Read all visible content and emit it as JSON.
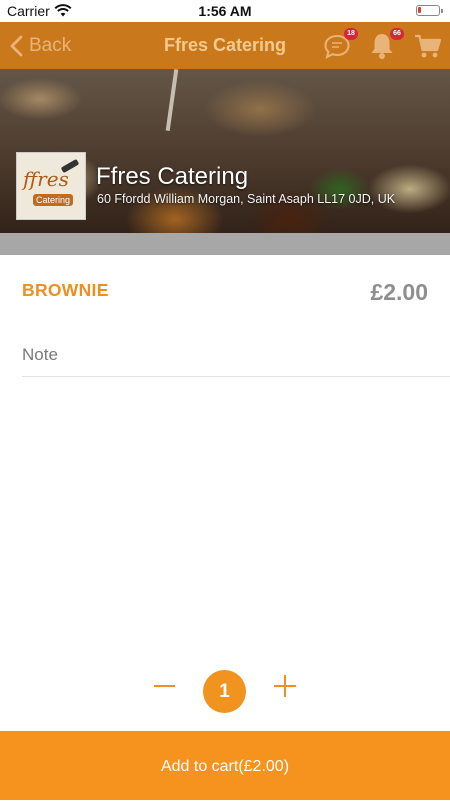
{
  "status_bar": {
    "carrier": "Carrier",
    "time": "1:56 AM"
  },
  "nav": {
    "back_label": "Back",
    "title": "Ffres Catering",
    "messages_badge": "18",
    "notifications_badge": "66",
    "icons": [
      "chevron-left-icon",
      "chat-icon",
      "bell-icon",
      "cart-icon"
    ]
  },
  "store": {
    "name": "Ffres Catering",
    "address": "60 Ffordd William Morgan, Saint Asaph LL17 0JD, UK",
    "logo_text_main": "ffres",
    "logo_text_sub": "Catering"
  },
  "item": {
    "name": "BROWNIE",
    "price": "£2.00",
    "note_placeholder": "Note",
    "note_value": ""
  },
  "quantity": {
    "value": "1"
  },
  "add_to_cart_label": "Add to cart(£2.00)",
  "colors": {
    "nav_bg": "#c9791b",
    "accent": "#f5931e",
    "item_name": "#ef8f1f",
    "price": "#8f8f8f",
    "badge": "#d6263a"
  }
}
